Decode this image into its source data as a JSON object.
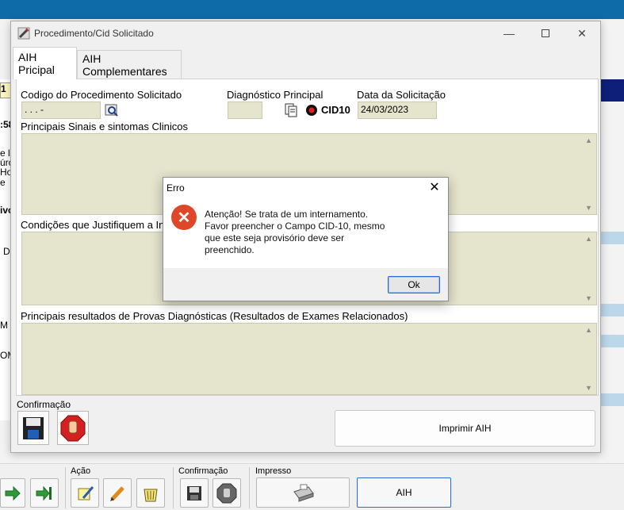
{
  "background": {
    "frag_yellow": "1",
    "frag_row1": ":58",
    "frag_row2a": "e l",
    "frag_row2b": "úrc",
    "frag_row2c": "Ho",
    "frag_row2d": "e",
    "frag_row3": "ivo",
    "frag_row4": "D",
    "frag_row5": "M",
    "frag_row6": "OM"
  },
  "window": {
    "title": "Procedimento/Cid Solicitado",
    "icon": "syringe-icon"
  },
  "tabs": [
    {
      "label": "AIH Pricipal",
      "active": true
    },
    {
      "label": "AIH Complementares",
      "active": false
    }
  ],
  "form": {
    "codigo_label": "Codigo do Procedimento Solicitado",
    "codigo_value": " .  .  .  -",
    "diagnostico_label": "Diagnóstico Principal",
    "diagnostico_value": "",
    "cid_label": "CID10",
    "data_label": "Data da Solicitação",
    "data_value": "24/03/2023",
    "sinais_label": "Principais Sinais e sintomas Clinicos",
    "condicoes_label": "Condições que Justifiquem a Internação",
    "resultados_label": "Principais resultados de Provas Diagnósticas (Resultados de Exames Relacionados)"
  },
  "confirmacao": {
    "label": "Confirmação",
    "save": "save-disk-icon",
    "cancel": "stop-hand-icon"
  },
  "print_button": "Imprimir AIH",
  "error_dialog": {
    "title": "Erro",
    "message": "Atenção! Se trata de um internamento.\nFavor preencher o Campo CID-10, mesmo\nque este seja provisório deve ser\npreenchido.",
    "ok_label": "Ok",
    "icon": "error-x-icon"
  },
  "toolbar": {
    "acao_label": "Ação",
    "confirmacao_label": "Confirmação",
    "impresso_label": "Impresso",
    "aih_label": "AIH"
  },
  "colors": {
    "field_bg": "#e5e4cd",
    "error_red": "#e0462a",
    "accent_blue": "#0f6aa8"
  }
}
